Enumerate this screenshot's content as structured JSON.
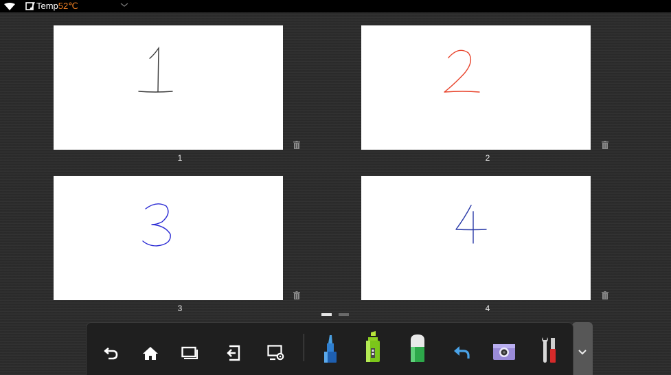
{
  "status_bar": {
    "temp_label": "Temp",
    "temp_value": "52℃",
    "icons": [
      "wifi-icon",
      "thermometer-note-icon",
      "chevron-down-icon"
    ]
  },
  "pages": [
    {
      "number": "1",
      "digit": "1",
      "ink_color": "#3a3a3a"
    },
    {
      "number": "2",
      "digit": "2",
      "ink_color": "#e8442c"
    },
    {
      "number": "3",
      "digit": "3",
      "ink_color": "#2b2bd4"
    },
    {
      "number": "4",
      "digit": "4",
      "ink_color": "#2a3aa8"
    }
  ],
  "pagination": {
    "current": 1,
    "total": 2
  },
  "toolbar": {
    "tools": [
      "back-icon",
      "home-icon",
      "window-icon",
      "exit-icon",
      "screen-settings-icon",
      "pen-icon",
      "highlighter-icon",
      "eraser-icon",
      "undo-icon",
      "camera-icon",
      "tools-icon"
    ],
    "expand_icon": "chevron-down-icon"
  },
  "colors": {
    "background": "#2b2b2b",
    "temperature": "#f07f22",
    "active_dot": "#e6e6e6",
    "inactive_dot": "#6a6a6a"
  }
}
